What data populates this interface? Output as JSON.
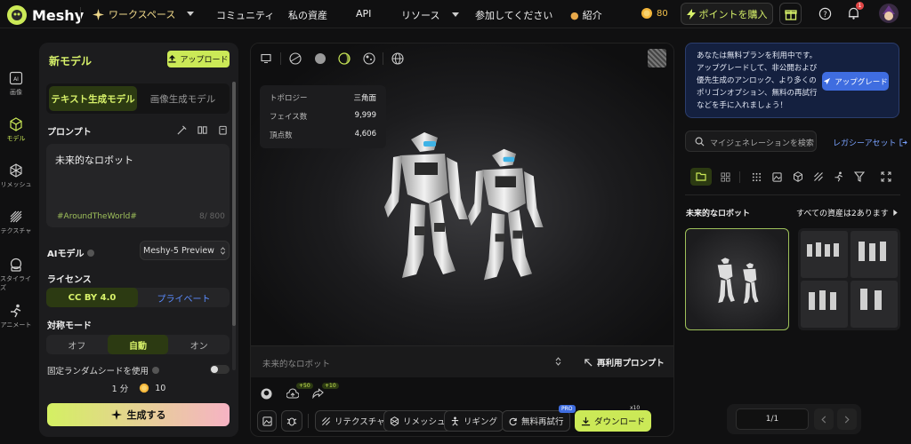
{
  "nav": {
    "logo": "Meshy",
    "workspace": "ワークスペース",
    "items": [
      "コミュニティ",
      "私の資産",
      "API",
      "リソース",
      "参加してください",
      "紹介"
    ],
    "coins": "80",
    "buy_points": "ポイントを購入",
    "notification_count": "1"
  },
  "rail": [
    {
      "label": "画像",
      "icon": "image-ai-icon"
    },
    {
      "label": "モデル",
      "icon": "cube-icon",
      "active": true
    },
    {
      "label": "リメッシュ",
      "icon": "remesh-icon"
    },
    {
      "label": "テクスチャ",
      "icon": "texture-icon"
    },
    {
      "label": "スタイライズ",
      "icon": "stylize-icon"
    },
    {
      "label": "アニメート",
      "icon": "animate-icon"
    }
  ],
  "panel": {
    "title": "新モデル",
    "upload": "アップロード",
    "tabs": [
      "テキスト生成モデル",
      "画像生成モデル"
    ],
    "prompt_label": "プロンプト",
    "prompt_value": "未来的なロボット",
    "hashtag": "#AroundTheWorld#",
    "char_count": "8/ 800",
    "ai_model_label": "AIモデル",
    "ai_model_value": "Meshy-5 Preview",
    "license_label": "ライセンス",
    "license_options": [
      "CC BY 4.0",
      "プライベート"
    ],
    "symmetry_label": "対称モード",
    "symmetry_options": [
      "オフ",
      "自動",
      "オン"
    ],
    "seed_label": "固定ランダムシードを使用",
    "time": "1 分",
    "cost": "10",
    "generate": "生成する"
  },
  "viewer": {
    "stats": [
      {
        "label": "トポロジー",
        "value": "三角面"
      },
      {
        "label": "フェイス数",
        "value": "9,999"
      },
      {
        "label": "頂点数",
        "value": "4,606"
      }
    ],
    "prompt": "未来的なロボット",
    "reuse_prompt": "再利用プロンプト",
    "badge_up": "+50",
    "badge_share": "+10",
    "tools": [
      "リテクスチャ",
      "リメッシュ",
      "リギング",
      "無料再試行",
      "ダウンロード"
    ],
    "pro_badge": "PRO",
    "download_x": "x10"
  },
  "right": {
    "promo_text": "あなたは無料プランを利用中です。アップグレードして、非公開および優先生成のアンロック、より多くのポリゴンオプション、無料の再試行などを手に入れましょう！",
    "upgrade": "アップグレード",
    "search_placeholder": "マイジェネレーションを検索",
    "legacy": "レガシーアセット",
    "asset_title": "未来的なロボット",
    "all_assets": "すべての資産は2あります",
    "page": "1/1"
  },
  "colors": {
    "accent": "#cbe957",
    "bg": "#101011",
    "panel": "#1c1c1e",
    "promo": "#14203f"
  }
}
